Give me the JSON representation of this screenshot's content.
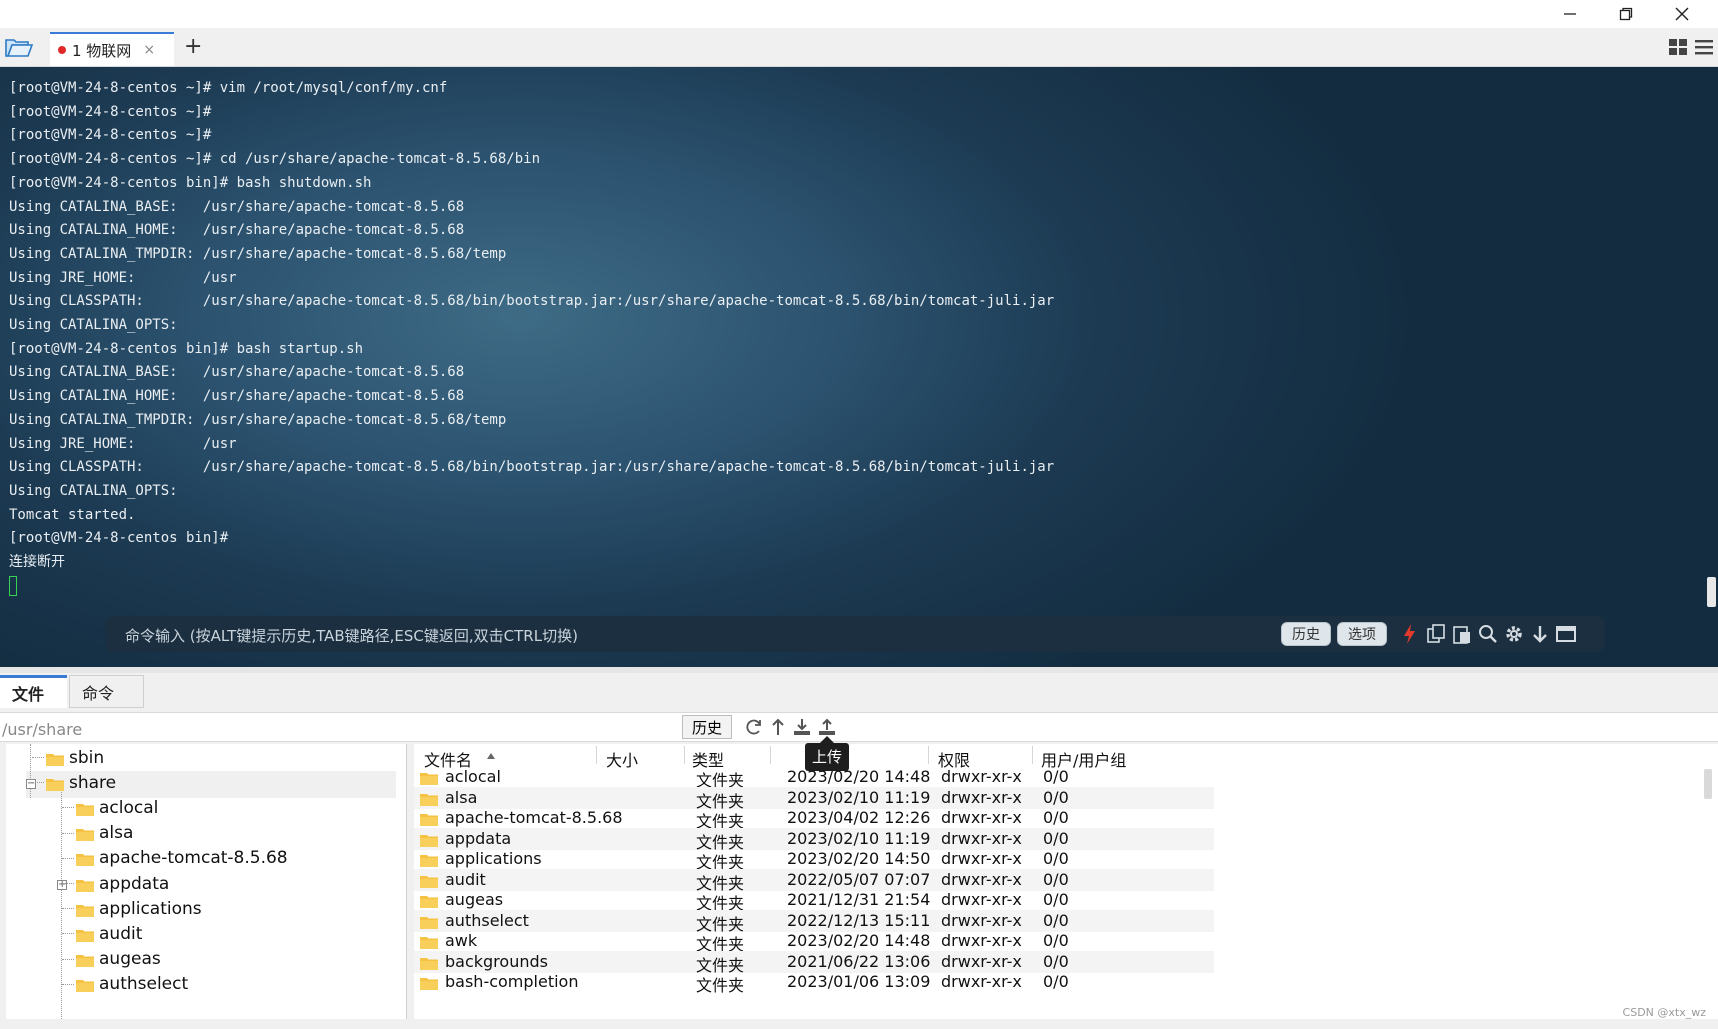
{
  "window": {
    "controls": [
      "minimize",
      "restore",
      "close"
    ]
  },
  "tabs": {
    "active_label": "1  物联网",
    "close_glyph": "×",
    "add_glyph": "+"
  },
  "terminal": {
    "lines": [
      "[root@VM-24-8-centos ~]# vim /root/mysql/conf/my.cnf",
      "[root@VM-24-8-centos ~]#",
      "[root@VM-24-8-centos ~]#",
      "[root@VM-24-8-centos ~]# cd /usr/share/apache-tomcat-8.5.68/bin",
      "[root@VM-24-8-centos bin]# bash shutdown.sh",
      "Using CATALINA_BASE:   /usr/share/apache-tomcat-8.5.68",
      "Using CATALINA_HOME:   /usr/share/apache-tomcat-8.5.68",
      "Using CATALINA_TMPDIR: /usr/share/apache-tomcat-8.5.68/temp",
      "Using JRE_HOME:        /usr",
      "Using CLASSPATH:       /usr/share/apache-tomcat-8.5.68/bin/bootstrap.jar:/usr/share/apache-tomcat-8.5.68/bin/tomcat-juli.jar",
      "Using CATALINA_OPTS:",
      "[root@VM-24-8-centos bin]# bash startup.sh",
      "Using CATALINA_BASE:   /usr/share/apache-tomcat-8.5.68",
      "Using CATALINA_HOME:   /usr/share/apache-tomcat-8.5.68",
      "Using CATALINA_TMPDIR: /usr/share/apache-tomcat-8.5.68/temp",
      "Using JRE_HOME:        /usr",
      "Using CLASSPATH:       /usr/share/apache-tomcat-8.5.68/bin/bootstrap.jar:/usr/share/apache-tomcat-8.5.68/bin/tomcat-juli.jar",
      "Using CATALINA_OPTS:",
      "Tomcat started.",
      "[root@VM-24-8-centos bin]#",
      "连接断开"
    ],
    "text_color": "#e9eef2",
    "cursor_color": "#39d353"
  },
  "cmdbar": {
    "placeholder": "命令输入 (按ALT键提示历史,TAB键路径,ESC键返回,双击CTRL切换)",
    "history_label": "历史",
    "options_label": "选项",
    "icons": [
      "lightning-icon",
      "copy-icon",
      "paste-icon",
      "search-icon",
      "gear-icon",
      "down-arrow-icon",
      "window-icon"
    ]
  },
  "bottom_tabs": {
    "files": "文件",
    "commands": "命令"
  },
  "pathbar": {
    "path": "/usr/share",
    "history_label": "历史",
    "tooltip": "上传",
    "icons": [
      "refresh-icon",
      "up-dir-icon",
      "download-icon",
      "upload-icon"
    ]
  },
  "tree": {
    "items": [
      {
        "label": "sbin",
        "level": 1
      },
      {
        "label": "share",
        "level": 1,
        "selected": true,
        "expanded": true
      },
      {
        "label": "aclocal",
        "level": 2
      },
      {
        "label": "alsa",
        "level": 2
      },
      {
        "label": "apache-tomcat-8.5.68",
        "level": 2,
        "collapsed": true
      },
      {
        "label": "appdata",
        "level": 2
      },
      {
        "label": "applications",
        "level": 2
      },
      {
        "label": "audit",
        "level": 2
      },
      {
        "label": "augeas",
        "level": 2
      },
      {
        "label": "authselect",
        "level": 2
      }
    ]
  },
  "file_list": {
    "columns": {
      "name": "文件名",
      "size": "大小",
      "type": "类型",
      "mtime": "时间",
      "perms": "权限",
      "owner": "用户/用户组"
    },
    "rows": [
      {
        "name": "aclocal",
        "size": "",
        "type": "文件夹",
        "mtime": "2023/02/20 14:48",
        "perms": "drwxr-xr-x",
        "owner": "0/0"
      },
      {
        "name": "alsa",
        "size": "",
        "type": "文件夹",
        "mtime": "2023/02/10 11:19",
        "perms": "drwxr-xr-x",
        "owner": "0/0"
      },
      {
        "name": "apache-tomcat-8.5.68",
        "size": "",
        "type": "文件夹",
        "mtime": "2023/04/02 12:26",
        "perms": "drwxr-xr-x",
        "owner": "0/0"
      },
      {
        "name": "appdata",
        "size": "",
        "type": "文件夹",
        "mtime": "2023/02/10 11:19",
        "perms": "drwxr-xr-x",
        "owner": "0/0"
      },
      {
        "name": "applications",
        "size": "",
        "type": "文件夹",
        "mtime": "2023/02/20 14:50",
        "perms": "drwxr-xr-x",
        "owner": "0/0"
      },
      {
        "name": "audit",
        "size": "",
        "type": "文件夹",
        "mtime": "2022/05/07 07:07",
        "perms": "drwxr-xr-x",
        "owner": "0/0"
      },
      {
        "name": "augeas",
        "size": "",
        "type": "文件夹",
        "mtime": "2021/12/31 21:54",
        "perms": "drwxr-xr-x",
        "owner": "0/0"
      },
      {
        "name": "authselect",
        "size": "",
        "type": "文件夹",
        "mtime": "2022/12/13 15:11",
        "perms": "drwxr-xr-x",
        "owner": "0/0"
      },
      {
        "name": "awk",
        "size": "",
        "type": "文件夹",
        "mtime": "2023/02/20 14:48",
        "perms": "drwxr-xr-x",
        "owner": "0/0"
      },
      {
        "name": "backgrounds",
        "size": "",
        "type": "文件夹",
        "mtime": "2021/06/22 13:06",
        "perms": "drwxr-xr-x",
        "owner": "0/0"
      },
      {
        "name": "bash-completion",
        "size": "",
        "type": "文件夹",
        "mtime": "2023/01/06 13:09",
        "perms": "drwxr-xr-x",
        "owner": "0/0"
      }
    ]
  },
  "watermark": "CSDN @xtx_wz",
  "colors": {
    "accent": "#3a7bd5",
    "folder": "#f5c242",
    "terminal_bg": "#1c3a52",
    "record_dot": "#e02a2a",
    "lightning": "#e03a2a"
  }
}
